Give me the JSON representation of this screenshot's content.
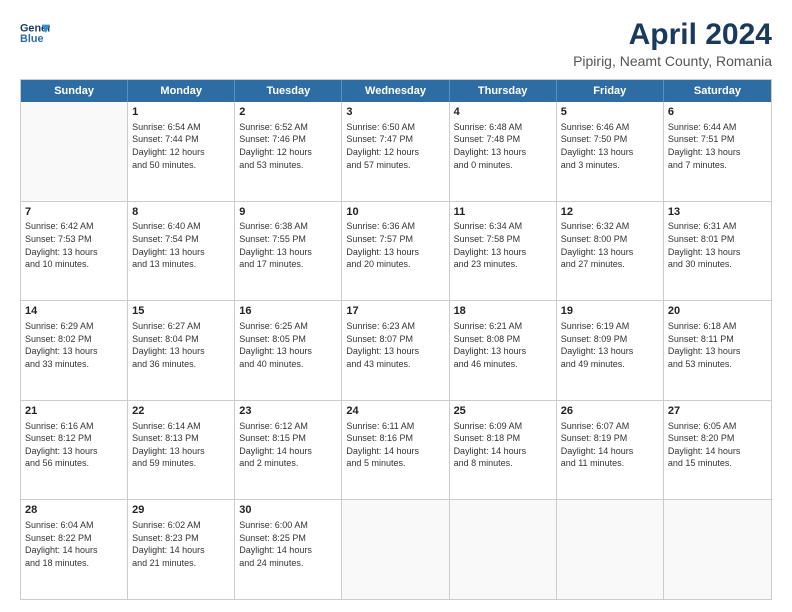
{
  "header": {
    "logo_line1": "General",
    "logo_line2": "Blue",
    "title": "April 2024",
    "subtitle": "Pipirig, Neamt County, Romania"
  },
  "weekdays": [
    "Sunday",
    "Monday",
    "Tuesday",
    "Wednesday",
    "Thursday",
    "Friday",
    "Saturday"
  ],
  "rows": [
    [
      {
        "day": "",
        "content": ""
      },
      {
        "day": "1",
        "content": "Sunrise: 6:54 AM\nSunset: 7:44 PM\nDaylight: 12 hours\nand 50 minutes."
      },
      {
        "day": "2",
        "content": "Sunrise: 6:52 AM\nSunset: 7:46 PM\nDaylight: 12 hours\nand 53 minutes."
      },
      {
        "day": "3",
        "content": "Sunrise: 6:50 AM\nSunset: 7:47 PM\nDaylight: 12 hours\nand 57 minutes."
      },
      {
        "day": "4",
        "content": "Sunrise: 6:48 AM\nSunset: 7:48 PM\nDaylight: 13 hours\nand 0 minutes."
      },
      {
        "day": "5",
        "content": "Sunrise: 6:46 AM\nSunset: 7:50 PM\nDaylight: 13 hours\nand 3 minutes."
      },
      {
        "day": "6",
        "content": "Sunrise: 6:44 AM\nSunset: 7:51 PM\nDaylight: 13 hours\nand 7 minutes."
      }
    ],
    [
      {
        "day": "7",
        "content": "Sunrise: 6:42 AM\nSunset: 7:53 PM\nDaylight: 13 hours\nand 10 minutes."
      },
      {
        "day": "8",
        "content": "Sunrise: 6:40 AM\nSunset: 7:54 PM\nDaylight: 13 hours\nand 13 minutes."
      },
      {
        "day": "9",
        "content": "Sunrise: 6:38 AM\nSunset: 7:55 PM\nDaylight: 13 hours\nand 17 minutes."
      },
      {
        "day": "10",
        "content": "Sunrise: 6:36 AM\nSunset: 7:57 PM\nDaylight: 13 hours\nand 20 minutes."
      },
      {
        "day": "11",
        "content": "Sunrise: 6:34 AM\nSunset: 7:58 PM\nDaylight: 13 hours\nand 23 minutes."
      },
      {
        "day": "12",
        "content": "Sunrise: 6:32 AM\nSunset: 8:00 PM\nDaylight: 13 hours\nand 27 minutes."
      },
      {
        "day": "13",
        "content": "Sunrise: 6:31 AM\nSunset: 8:01 PM\nDaylight: 13 hours\nand 30 minutes."
      }
    ],
    [
      {
        "day": "14",
        "content": "Sunrise: 6:29 AM\nSunset: 8:02 PM\nDaylight: 13 hours\nand 33 minutes."
      },
      {
        "day": "15",
        "content": "Sunrise: 6:27 AM\nSunset: 8:04 PM\nDaylight: 13 hours\nand 36 minutes."
      },
      {
        "day": "16",
        "content": "Sunrise: 6:25 AM\nSunset: 8:05 PM\nDaylight: 13 hours\nand 40 minutes."
      },
      {
        "day": "17",
        "content": "Sunrise: 6:23 AM\nSunset: 8:07 PM\nDaylight: 13 hours\nand 43 minutes."
      },
      {
        "day": "18",
        "content": "Sunrise: 6:21 AM\nSunset: 8:08 PM\nDaylight: 13 hours\nand 46 minutes."
      },
      {
        "day": "19",
        "content": "Sunrise: 6:19 AM\nSunset: 8:09 PM\nDaylight: 13 hours\nand 49 minutes."
      },
      {
        "day": "20",
        "content": "Sunrise: 6:18 AM\nSunset: 8:11 PM\nDaylight: 13 hours\nand 53 minutes."
      }
    ],
    [
      {
        "day": "21",
        "content": "Sunrise: 6:16 AM\nSunset: 8:12 PM\nDaylight: 13 hours\nand 56 minutes."
      },
      {
        "day": "22",
        "content": "Sunrise: 6:14 AM\nSunset: 8:13 PM\nDaylight: 13 hours\nand 59 minutes."
      },
      {
        "day": "23",
        "content": "Sunrise: 6:12 AM\nSunset: 8:15 PM\nDaylight: 14 hours\nand 2 minutes."
      },
      {
        "day": "24",
        "content": "Sunrise: 6:11 AM\nSunset: 8:16 PM\nDaylight: 14 hours\nand 5 minutes."
      },
      {
        "day": "25",
        "content": "Sunrise: 6:09 AM\nSunset: 8:18 PM\nDaylight: 14 hours\nand 8 minutes."
      },
      {
        "day": "26",
        "content": "Sunrise: 6:07 AM\nSunset: 8:19 PM\nDaylight: 14 hours\nand 11 minutes."
      },
      {
        "day": "27",
        "content": "Sunrise: 6:05 AM\nSunset: 8:20 PM\nDaylight: 14 hours\nand 15 minutes."
      }
    ],
    [
      {
        "day": "28",
        "content": "Sunrise: 6:04 AM\nSunset: 8:22 PM\nDaylight: 14 hours\nand 18 minutes."
      },
      {
        "day": "29",
        "content": "Sunrise: 6:02 AM\nSunset: 8:23 PM\nDaylight: 14 hours\nand 21 minutes."
      },
      {
        "day": "30",
        "content": "Sunrise: 6:00 AM\nSunset: 8:25 PM\nDaylight: 14 hours\nand 24 minutes."
      },
      {
        "day": "",
        "content": ""
      },
      {
        "day": "",
        "content": ""
      },
      {
        "day": "",
        "content": ""
      },
      {
        "day": "",
        "content": ""
      }
    ]
  ]
}
